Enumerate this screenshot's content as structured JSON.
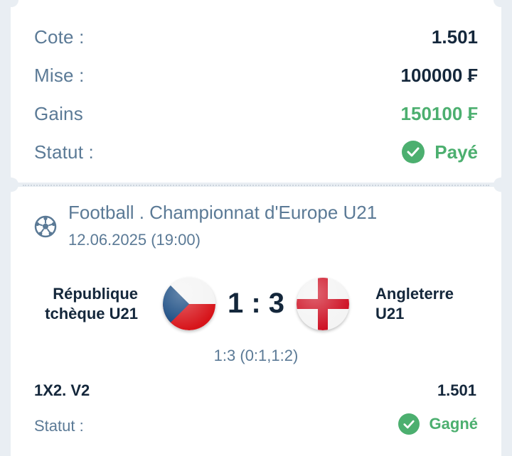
{
  "summary": {
    "odds_label": "Cote :",
    "odds_value": "1.501",
    "stake_label": "Mise :",
    "stake_value": "100000 ₣",
    "winnings_label": "Gains",
    "winnings_value": "150100 ₣",
    "status_label": "Statut :",
    "status_value": "Payé"
  },
  "event": {
    "sport_icon": "football-icon",
    "title": "Football . Championnat d'Europe U21",
    "datetime": "12.06.2025 (19:00)",
    "home_team_line1": "République",
    "home_team_line2": "tchèque U21",
    "away_team_line1": "Angleterre",
    "away_team_line2": "U21",
    "score": "1 : 3",
    "score_detail": "1:3 (0:1,1:2)"
  },
  "bet": {
    "market": "1X2. V2",
    "odds": "1.501",
    "status_label": "Statut :",
    "status_value": "Gagné"
  },
  "colors": {
    "accent_green": "#4caf6f",
    "label_blue": "#5b7a96",
    "text_dark": "#14273b",
    "background": "#e9eef3"
  }
}
